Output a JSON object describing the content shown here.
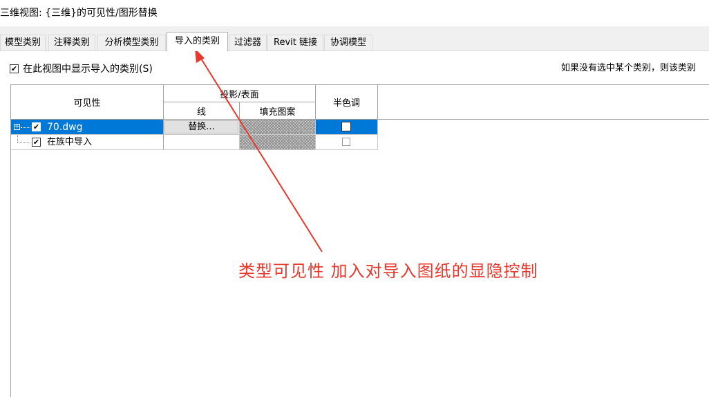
{
  "window": {
    "title": "三维视图: {三维}的可见性/图形替换"
  },
  "tabs": [
    {
      "label": "模型类别",
      "active": false
    },
    {
      "label": "注释类别",
      "active": false
    },
    {
      "label": "分析模型类别",
      "active": false
    },
    {
      "label": "导入的类别",
      "active": true
    },
    {
      "label": "过滤器",
      "active": false
    },
    {
      "label": "Revit 链接",
      "active": false
    },
    {
      "label": "协调模型",
      "active": false
    }
  ],
  "show_imported": {
    "label": "在此视图中显示导入的类别(S)",
    "checked": true
  },
  "hint": "如果没有选中某个类别，则该类别",
  "table": {
    "headers": {
      "visibility": "可见性",
      "projection_surface": "投影/表面",
      "lines": "线",
      "fill_pattern": "填充图案",
      "halftone": "半色调"
    },
    "rows": [
      {
        "name": "70.dwg",
        "checked": true,
        "expanded": false,
        "selected": true,
        "lines_button": "替换...",
        "halftone": false
      },
      {
        "name": "在族中导入",
        "checked": true,
        "expanded": false,
        "selected": false,
        "lines_button": "",
        "halftone": false
      }
    ]
  },
  "annotation": {
    "text": "类型可见性  加入对导入图纸的显隐控制",
    "color": "#e8372b"
  },
  "colors": {
    "selection": "#0078d7",
    "tabbar": "#f0f0f0"
  }
}
